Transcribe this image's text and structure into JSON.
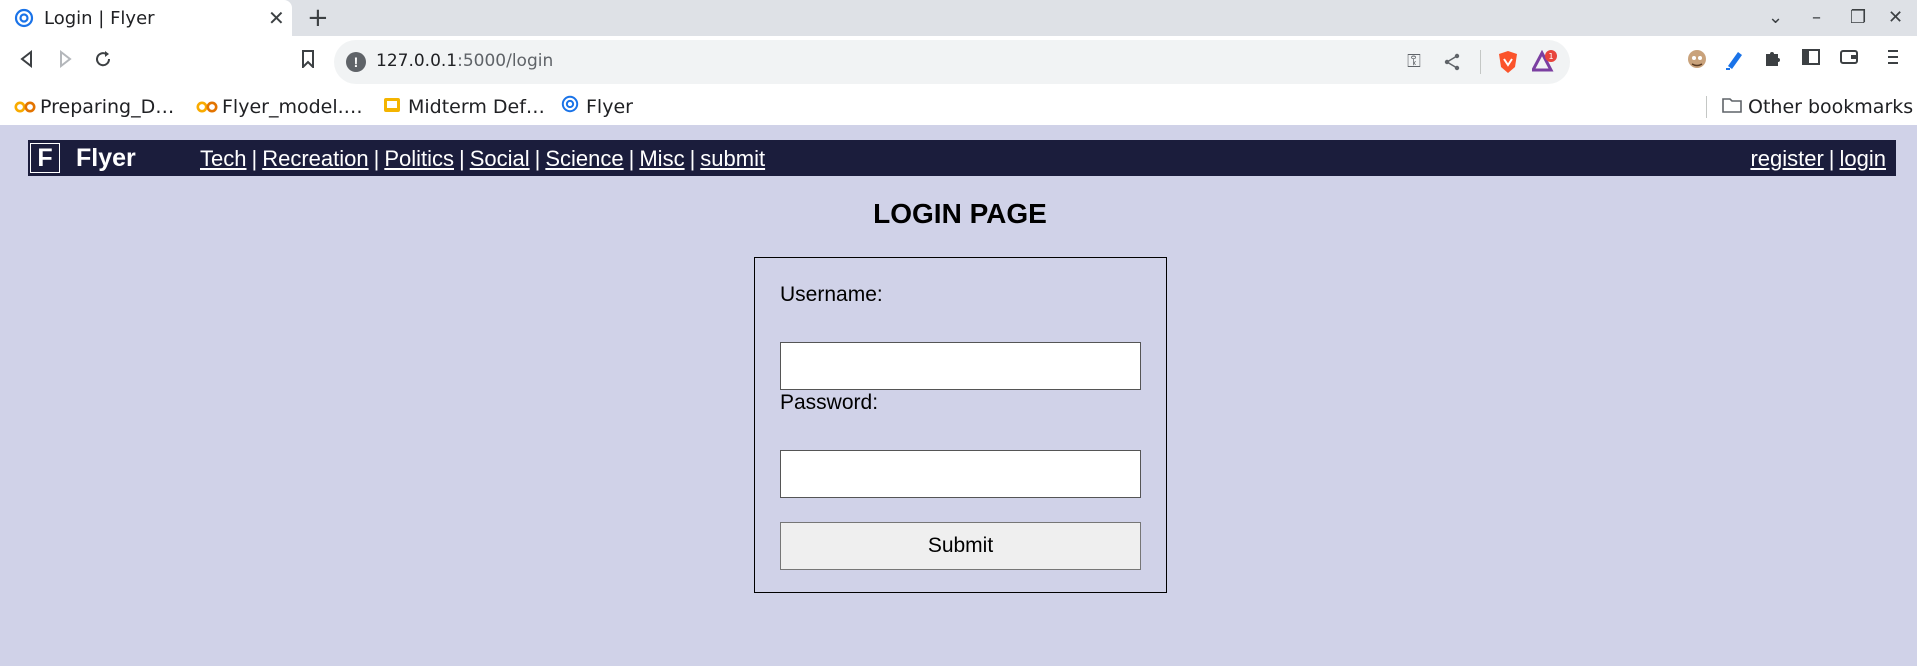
{
  "browser": {
    "tab": {
      "title": "Login | Flyer",
      "close_glyph": "✕",
      "favicon": "flyer-swirl-icon"
    },
    "new_tab_glyph": "+",
    "window_controls": {
      "tab_search": "⌄",
      "minimize": "–",
      "restore": "❐",
      "close": "✕"
    },
    "address_bar": {
      "host": "127.0.0.1",
      "path": ":5000/login"
    },
    "bookmarks": [
      {
        "label": "Preparing_D…",
        "icon": "colab-icon"
      },
      {
        "label": "Flyer_model.…",
        "icon": "colab-icon"
      },
      {
        "label": "Midterm Def…",
        "icon": "slides-icon"
      },
      {
        "label": "Flyer",
        "icon": "flyer-swirl-icon"
      }
    ],
    "other_bookmarks": "Other bookmarks",
    "colors": {
      "tabstrip": "#dee1e6",
      "brave_orange": "#fb542b",
      "badge_red": "#e8453c"
    }
  },
  "site": {
    "logo_letter": "F",
    "brand": "Flyer",
    "nav": [
      "Tech",
      "Recreation",
      "Politics",
      "Social",
      "Science",
      "Misc",
      "submit"
    ],
    "separator": "|",
    "auth": [
      "register",
      "login"
    ],
    "colors": {
      "navbar": "#1b1d3c",
      "page_bg": "#d0d2e8"
    }
  },
  "login": {
    "title": "LOGIN PAGE",
    "username_label": "Username:",
    "password_label": "Password:",
    "username_value": "",
    "password_value": "",
    "submit_label": "Submit"
  }
}
